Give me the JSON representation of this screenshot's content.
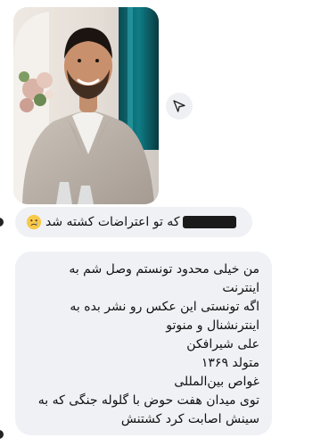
{
  "messages": [
    {
      "type": "photo",
      "share_icon": "send-arrow-icon"
    },
    {
      "type": "text",
      "redacted": true,
      "text": "که تو اعتراضات کشته شد",
      "emoji": "crying-face"
    },
    {
      "type": "text",
      "lines": [
        "من خیلی محدود تونستم وصل شم به",
        "اینترنت",
        "اگه تونستی این عکس رو نشر بده به",
        "اینترنشنال و منوتو",
        "علی شیرافکن",
        "متولد ۱۳۶۹",
        "غواص بین‌المللی",
        "توی میدان هفت حوض با گلوله جنگی که به",
        "سینش اصابت کرد کشتنش"
      ]
    }
  ],
  "colors": {
    "bubble_bg": "#eff1f5",
    "text": "#111111",
    "background": "#ffffff"
  }
}
